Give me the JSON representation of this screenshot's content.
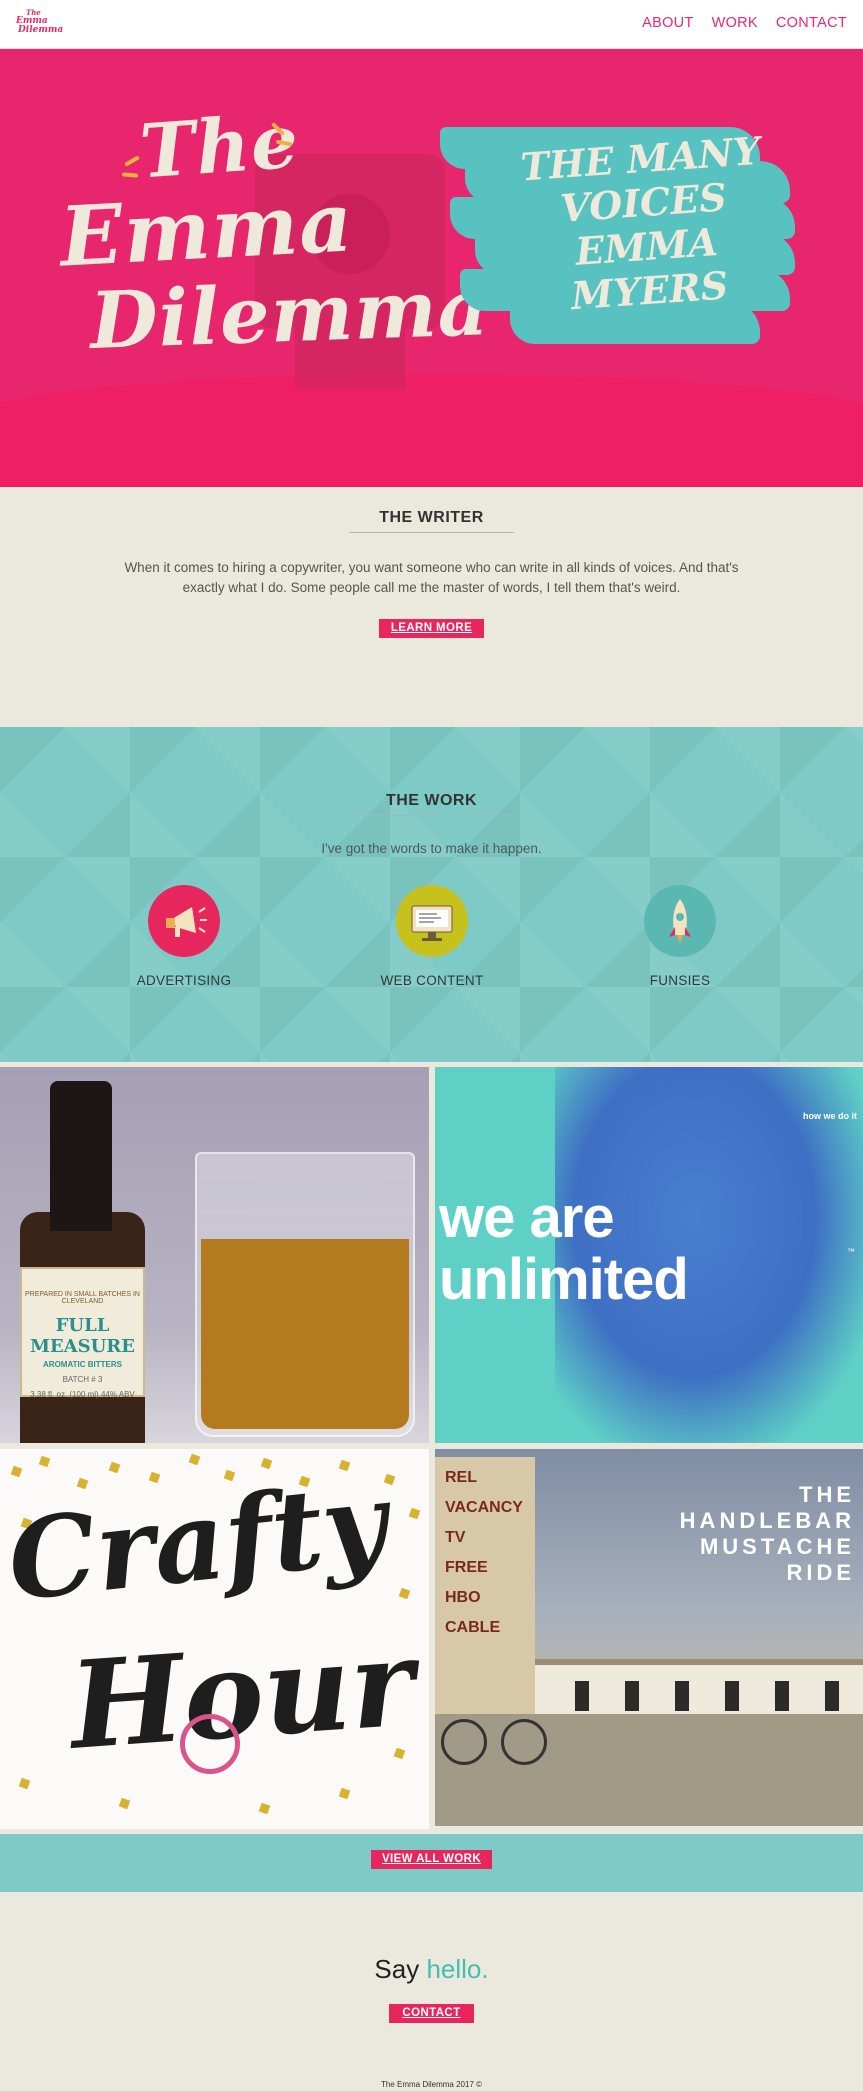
{
  "header": {
    "logo_lines": [
      "The",
      "Emma",
      "Dilemma"
    ],
    "nav": [
      "ABOUT",
      "WORK",
      "CONTACT"
    ]
  },
  "hero": {
    "title_lines": [
      "The",
      "Emma",
      "Dilemma"
    ],
    "tagline_lines": [
      "THE MANY",
      "VOICES",
      "EMMA",
      "MYERS"
    ],
    "colors": {
      "background": "#e8266d",
      "brush": "#57c2c0",
      "lettering": "#efe9dc"
    }
  },
  "writer": {
    "title": "THE WRITER",
    "body": "When it comes to hiring a copywriter, you want someone who can write in all kinds of voices. And that's exactly what I do. Some people call me the master of words, I tell them that's weird.",
    "button": "LEARN MORE"
  },
  "work": {
    "title": "THE WORK",
    "subtitle": "I've got the words to make it happen.",
    "categories": [
      {
        "label": "ADVERTISING",
        "icon": "megaphone-icon",
        "color": "#e8265e"
      },
      {
        "label": "WEB CONTENT",
        "icon": "monitor-icon",
        "color": "#c7c11d"
      },
      {
        "label": "FUNSIES",
        "icon": "rocket-icon",
        "color": "#5ab7b1"
      }
    ]
  },
  "portfolio": {
    "bitters": {
      "small": "PREPARED IN SMALL BATCHES IN CLEVELAND",
      "brand": "FULL MEASURE",
      "product": "AROMATIC BITTERS",
      "batch": "BATCH # 3",
      "volume": "3.38 fl. oz. (100 ml) 44% ABV"
    },
    "unlimited": {
      "small": "how we do it",
      "lines": [
        "we are",
        "unlimited"
      ],
      "mark": "™"
    },
    "crafty": {
      "lines": [
        "Crafty",
        "Hour"
      ]
    },
    "handlebar": {
      "lines": [
        "THE",
        "HANDLEBAR",
        "MUSTACHE",
        "RIDE"
      ],
      "sign_lines": [
        "REL",
        "VACANCY",
        "TV",
        "FREE",
        "HBO",
        "CABLE"
      ]
    }
  },
  "view_all": {
    "button": "VIEW ALL WORK"
  },
  "contact": {
    "say": "Say",
    "hello": "hello",
    "dot": ".",
    "button": "CONTACT",
    "footer": "The Emma Dilemma 2017 ©"
  }
}
